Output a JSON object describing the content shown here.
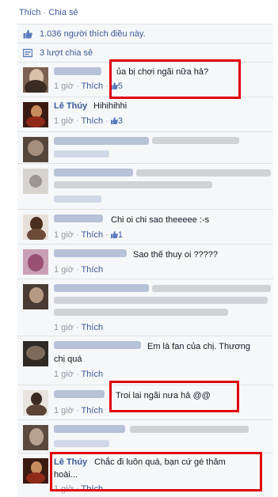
{
  "actions": {
    "like": "Thích",
    "dot": "·",
    "share": "Chia sẻ"
  },
  "summary": {
    "likes_text": "1.036 người thích điều này.",
    "shares_text": "3 lượt chia sẻ"
  },
  "comment_meta": {
    "time": "1 giờ",
    "like": "Thích"
  },
  "comments": [
    {
      "text": "ủa bị chơi ngãi nữa hả?",
      "likes": "5"
    },
    {
      "author": "Lê Thúy",
      "text": "Hihihihhi",
      "likes": "3"
    },
    {
      "text": "",
      "likes": ""
    },
    {
      "text": "",
      "likes": ""
    },
    {
      "text": "Chi oi chi sao theeeee :-s",
      "likes": "1"
    },
    {
      "text": "Sao thế thuy oi ?????",
      "likes": ""
    },
    {
      "text": "",
      "likes": ""
    },
    {
      "text_line1": "Em là fan của chị. Thương",
      "text_line2": "chị quá",
      "likes": ""
    },
    {
      "text": "Troi lai ngãi nưa hả @@",
      "likes": ""
    },
    {
      "text": "",
      "likes": ""
    },
    {
      "author": "Lê Thúy",
      "text_line1": "Chắc đi luôn quá, bạn cứ gé thăm",
      "text_line2": "hoài...",
      "likes": ""
    }
  ],
  "colors": {
    "link": "#3b5998",
    "panel": "#f6f7f9",
    "highlight": "#e0000d"
  },
  "icons": [
    "thumbs-up-icon",
    "share-icon",
    "small-like-icon"
  ]
}
